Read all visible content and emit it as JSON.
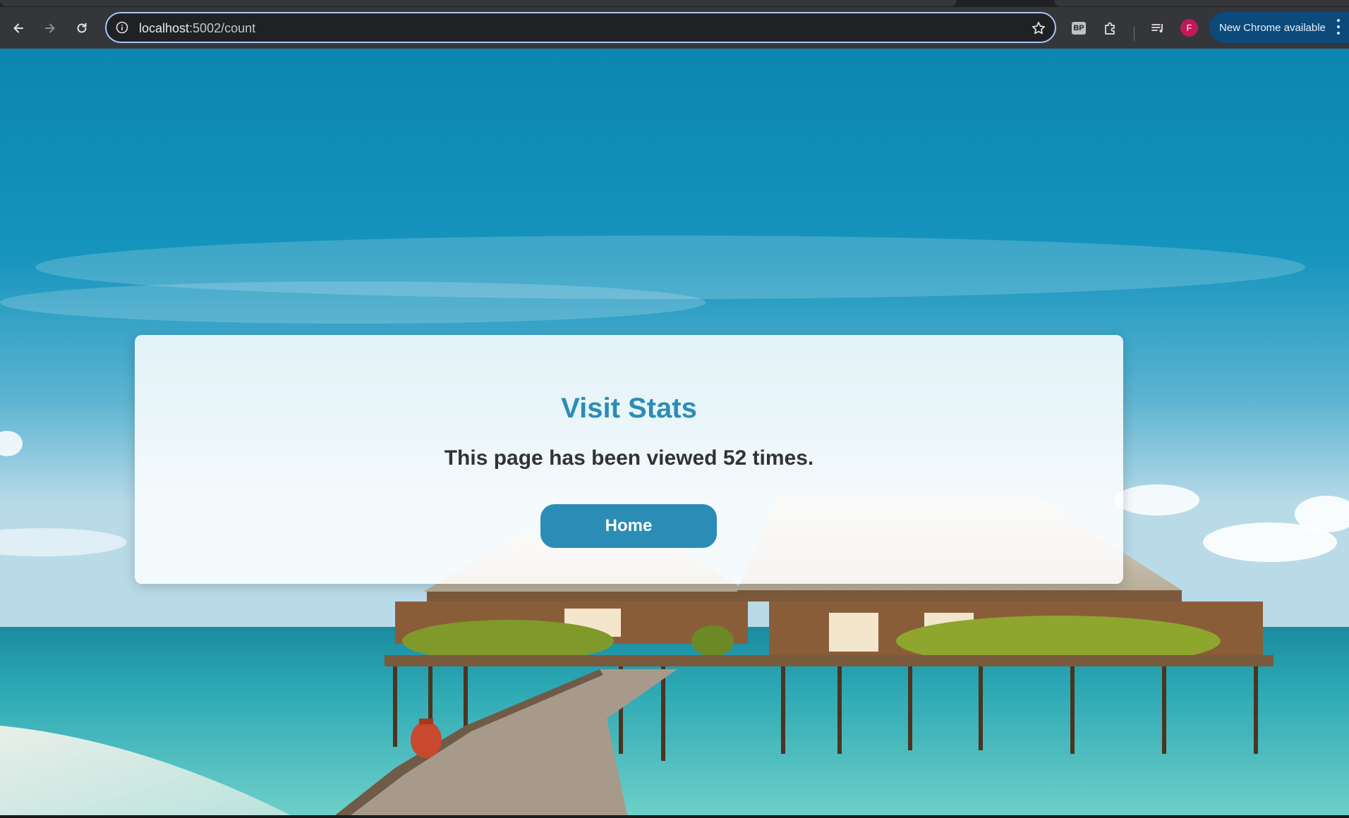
{
  "browser": {
    "url_host": "localhost",
    "url_path": ":5002/count",
    "extension_badge": "BP",
    "profile_initial": "F",
    "update_label": "New Chrome available"
  },
  "page": {
    "heading": "Visit Stats",
    "message": "This page has been viewed 52 times.",
    "home_button": "Home"
  },
  "colors": {
    "accent": "#2b8db5",
    "text_dark": "#333333",
    "chrome_bg": "#35363a",
    "update_pill": "#0b4a7a",
    "avatar": "#c2185b"
  },
  "icons": [
    "back-arrow-icon",
    "forward-arrow-icon",
    "reload-icon",
    "site-info-icon",
    "bookmark-star-icon",
    "extensions-puzzle-icon",
    "media-controls-icon",
    "more-vert-icon"
  ]
}
